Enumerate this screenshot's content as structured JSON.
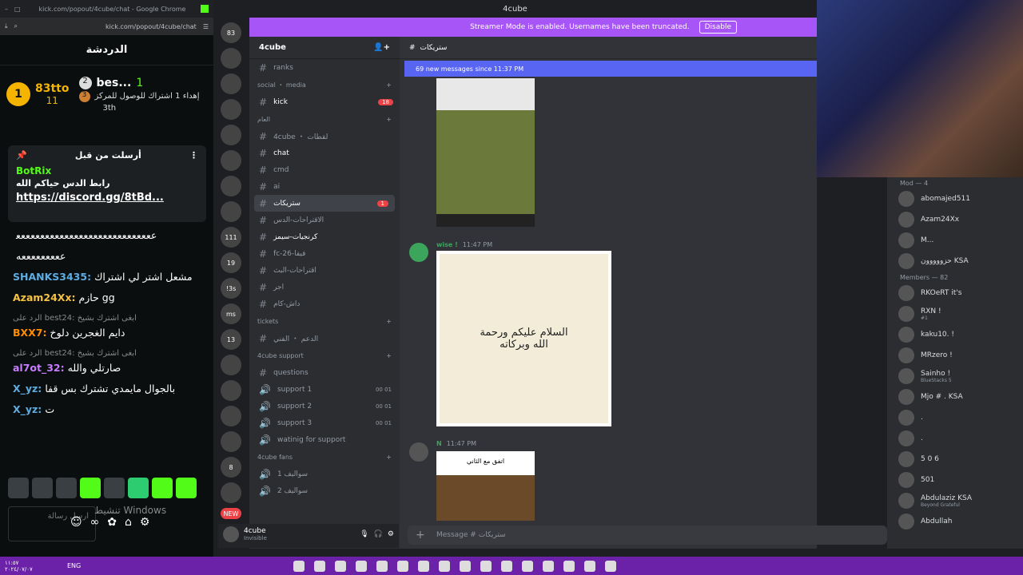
{
  "kick": {
    "window_title": "kick.com/popout/4cube/chat - Google Chrome",
    "url": "kick.com/popout/4cube/chat",
    "chat_title": "الدردشة",
    "leaderboard": {
      "first_name": "83tto",
      "first_rank": "1",
      "first_count": "11",
      "second_rank": "2",
      "second_name": "bes...",
      "second_count": "1",
      "third_rank": "3",
      "third_text": "إهداء 1 اشتراك للوصول للمركز",
      "third_place": "3th"
    },
    "pinned": {
      "sent_by": "أرسلت من قبل",
      "author": "BotRix",
      "text": "رابط الدس حياكم الله",
      "link": "https://discord.gg/8tBd..."
    },
    "messages": [
      {
        "user": "",
        "text": "ﻋﻌﻌﻌﻌﻌﻌﻌﻌﻌﻌﻌﻌﻌﻌﻌﻌﻌﻌﻌﻌﻌﻌﻌﻌﻌﻌﻌﻌ",
        "color": "#ffffff"
      },
      {
        "user": "",
        "text": "ﻋﻌﻌﻌﻌﻌﻌﻌﻌﻪ",
        "color": "#ffffff"
      },
      {
        "user": "SHANKS3435:",
        "text": "مشعل اشتر لي اشتراك",
        "color": "#5dade2"
      },
      {
        "user": "Azam24Xx:",
        "text": "حازم gg",
        "color": "#f5c242"
      },
      {
        "reply": "الرد على best24: ابغى اشترك بشيخ",
        "user": "BXX7:",
        "text": "دايم الغجرين دلوخ",
        "color": "#ff8c00"
      },
      {
        "reply": "الرد على best24: ابغى اشترك بشيخ",
        "user": "al7ot_32:",
        "text": "صارتلي والله",
        "color": "#c77dff"
      },
      {
        "user": "X_yz:",
        "text": "بالجوال مايمدي تشترك بس قفا",
        "color": "#5dade2"
      },
      {
        "user": "X_yz:",
        "text": "ت",
        "color": "#5dade2"
      }
    ],
    "input_placeholder": "ارسل رسالة",
    "windows_watermark": "تنشيط Windows"
  },
  "discord": {
    "window_title": "4cube",
    "streamer_notice": "Streamer Mode is enabled. Usernames have been truncated.",
    "disable_label": "Disable",
    "server_name": "4cube",
    "server_badges": [
      "83",
      "",
      "",
      "",
      "",
      "",
      "",
      "",
      "111",
      "19",
      "!3s",
      "ms",
      "13",
      "",
      "",
      "",
      "",
      "8",
      "",
      "NEW"
    ],
    "channels": [
      {
        "type": "channel",
        "label": "ranks"
      },
      {
        "type": "category",
        "label": "social ・ media"
      },
      {
        "type": "channel",
        "label": "kick",
        "badge": "18",
        "bold": true
      },
      {
        "type": "category",
        "label": "العام"
      },
      {
        "type": "channel",
        "label": "4cube ・ لقطات"
      },
      {
        "type": "channel",
        "label": "chat",
        "bold": true
      },
      {
        "type": "channel",
        "label": "cmd"
      },
      {
        "type": "channel",
        "label": "ai"
      },
      {
        "type": "channel",
        "label": "ستريكات",
        "badge": "1",
        "active": true
      },
      {
        "type": "channel",
        "label": "الاقتراحات-الدس"
      },
      {
        "type": "channel",
        "label": "كرنجيات-سيمز",
        "bold": true
      },
      {
        "type": "channel",
        "label": "fc-26-فيفا"
      },
      {
        "type": "channel",
        "label": "اقتراحات-البث"
      },
      {
        "type": "channel",
        "label": "اجر"
      },
      {
        "type": "channel",
        "label": "داش-كام"
      },
      {
        "type": "category",
        "label": "tickets"
      },
      {
        "type": "channel",
        "label": "الدعم ・ الفني"
      },
      {
        "type": "category",
        "label": "4cube support"
      },
      {
        "type": "channel",
        "label": "questions"
      },
      {
        "type": "voice",
        "label": "support 1",
        "counts": "00 01"
      },
      {
        "type": "voice",
        "label": "support 2",
        "counts": "00 01"
      },
      {
        "type": "voice",
        "label": "support 3",
        "counts": "00 01"
      },
      {
        "type": "voice",
        "label": "watinig for support"
      },
      {
        "type": "category",
        "label": "4cube fans"
      },
      {
        "type": "voice",
        "label": "سواليف 1"
      },
      {
        "type": "voice",
        "label": "سواليف 2"
      }
    ],
    "channel_header": "ستريكات",
    "new_messages": "69 new messages since 11:37 PM",
    "msg1": {
      "author": "wise !",
      "time": "11:47 PM"
    },
    "msg2": {
      "author": "N",
      "time": "11:47 PM"
    },
    "image_greeting": "السلام عليكم ورحمة الله وبركاته",
    "image_caption": "اتفق مع الثاني",
    "composer_placeholder": "Message # ستريكات",
    "user": {
      "name": "4cube",
      "status": "Invisible"
    }
  },
  "members": {
    "mod_header": "Mod — 4",
    "mods": [
      {
        "name": "abomajed511"
      },
      {
        "name": "Azam24Xx"
      },
      {
        "name": "M..."
      },
      {
        "name": "حزووووون KSA"
      }
    ],
    "members_header": "Members — 82",
    "list": [
      {
        "name": "RKOeRT it's"
      },
      {
        "name": "RXN !",
        "sub": "#1"
      },
      {
        "name": "kaku10. !"
      },
      {
        "name": "MRzero !"
      },
      {
        "name": "Sainho !",
        "sub": "BlueStacks 5"
      },
      {
        "name": "Mjo # . KSA"
      },
      {
        "name": "."
      },
      {
        "name": "."
      },
      {
        "name": "5 0 6"
      },
      {
        "name": "501"
      },
      {
        "name": "Abdulaziz KSA",
        "sub": "Beyond Grateful"
      },
      {
        "name": "Abdullah"
      }
    ]
  },
  "taskbar": {
    "date": "٢٠٢٤/٠٧/٠٧",
    "time": "١١:٥٧",
    "lang": "ENG"
  }
}
